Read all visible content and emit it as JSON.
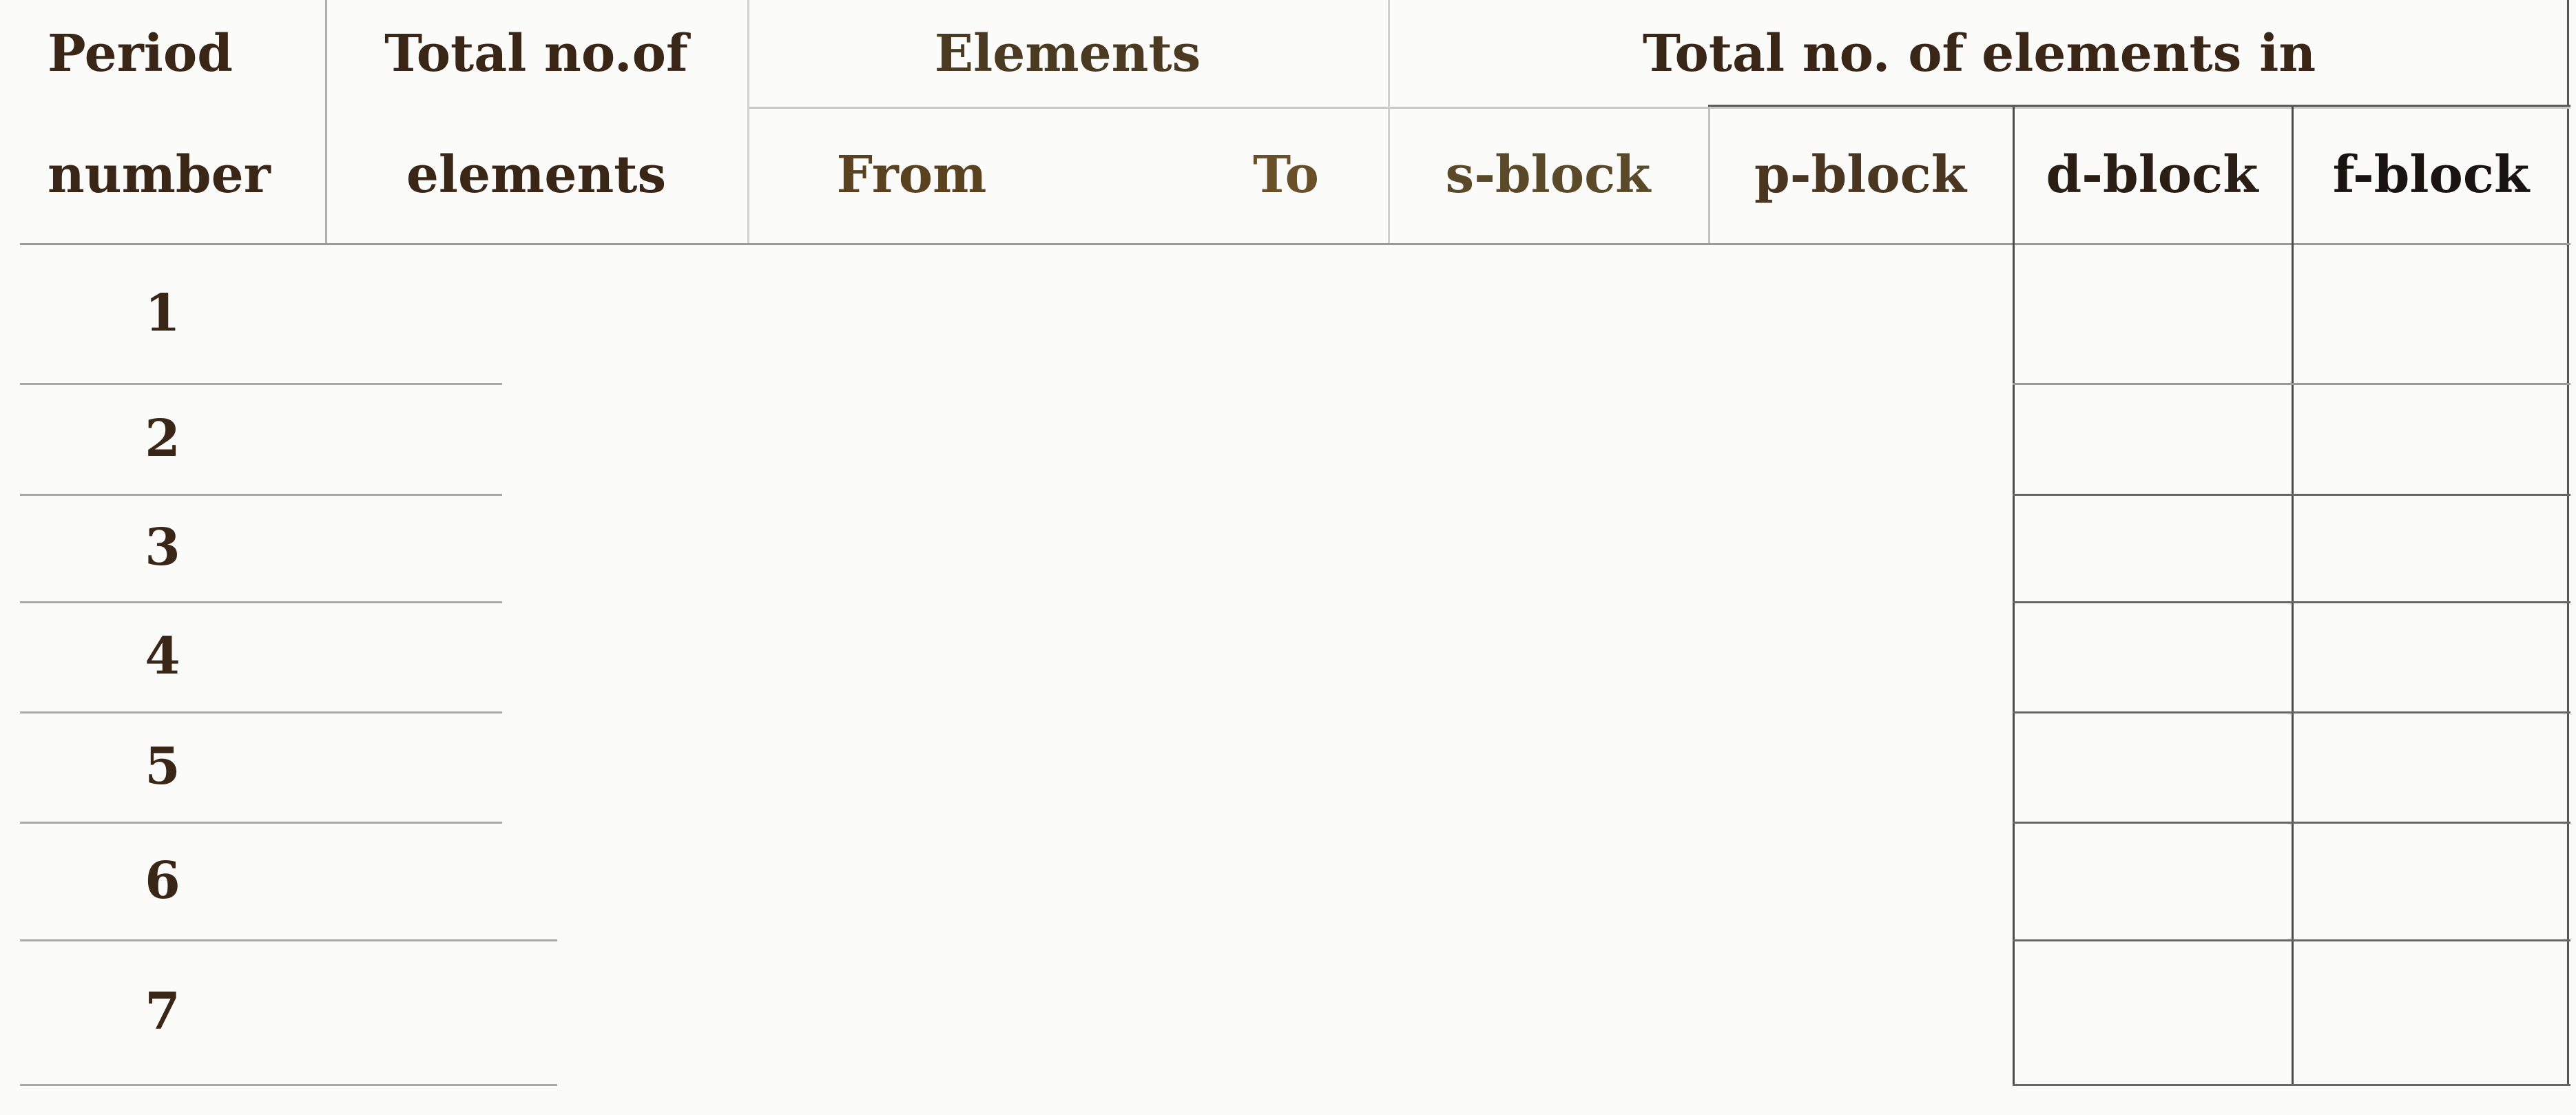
{
  "table": {
    "headers": {
      "period_number": [
        "Period",
        "number"
      ],
      "total_elements": [
        "Total no.of",
        "elements"
      ],
      "elements": "Elements",
      "from": "From",
      "to": "To",
      "total_in": "Total no. of elements in",
      "s_block": "s-block",
      "p_block": "p-block",
      "d_block": "d-block",
      "f_block": "f-block"
    },
    "periods": [
      "1",
      "2",
      "3",
      "4",
      "5",
      "6",
      "7"
    ]
  }
}
